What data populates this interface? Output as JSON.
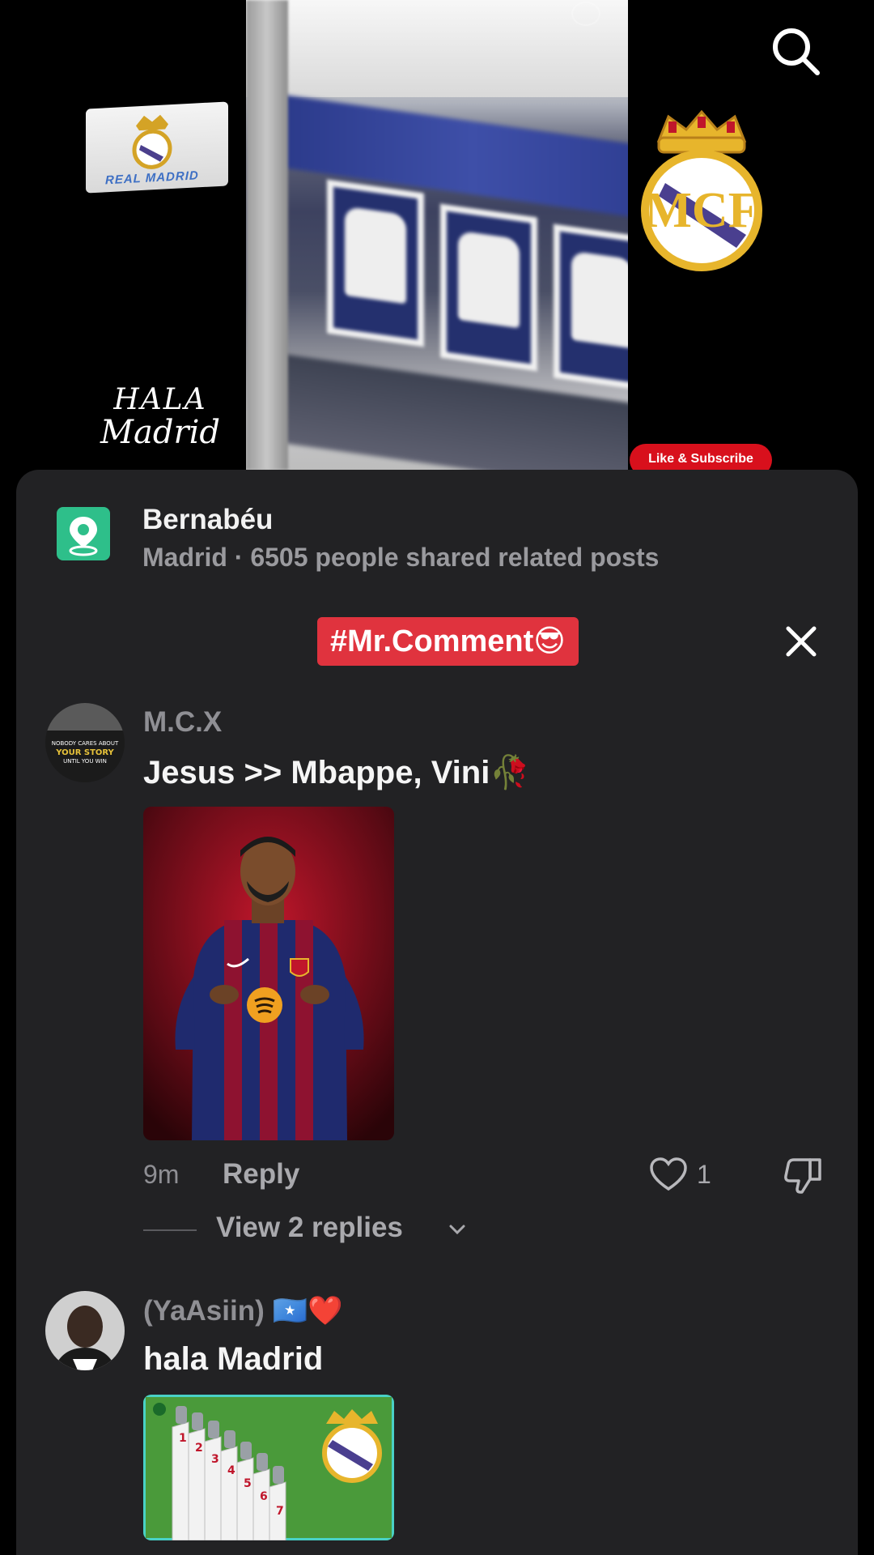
{
  "video": {
    "overlay_text_line1": "HALA",
    "overlay_text_line2": "Madrid",
    "flag_text": "REAL MADRID",
    "subscribe_badge": "Like & Subscribe",
    "search_icon": "search-icon"
  },
  "location": {
    "name": "Bernabéu",
    "meta": "Madrid · 6505 people shared related posts",
    "icon": "map-pin-icon",
    "icon_color": "#2ebf8a"
  },
  "tag": {
    "label": "#Mr.Comment😎",
    "color": "#e0333e",
    "close_icon": "close-icon"
  },
  "comments": [
    {
      "username": "M.C.X",
      "avatar_text": "NOBODY CARES ABOUT YOUR STORY UNTIL YOU WIN",
      "text": "Jesus >> Mbappe, Vini🥀",
      "time": "9m",
      "reply_label": "Reply",
      "like_count": "1",
      "view_replies": "View 2 replies"
    },
    {
      "username": "(YaAsiin) 🇸🇴❤️",
      "text": "hala Madrid",
      "image_numbers": [
        "1",
        "2",
        "3",
        "4",
        "5",
        "6",
        "7"
      ]
    }
  ]
}
